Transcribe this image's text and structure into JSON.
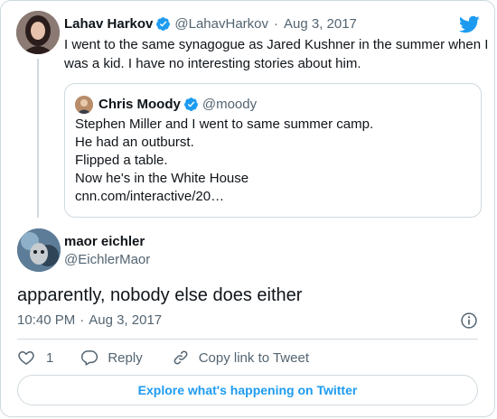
{
  "parent_tweet": {
    "display_name": "Lahav Harkov",
    "handle": "@LahavHarkov",
    "separator": "·",
    "date": "Aug 3, 2017",
    "text": "I went to the same synagogue as Jared Kushner in the summer when I was a kid. I have no interesting stories about him."
  },
  "quoted_tweet": {
    "display_name": "Chris Moody",
    "handle": "@moody",
    "lines": [
      "Stephen Miller and I went to same summer camp.",
      "He had an outburst.",
      "Flipped a table.",
      "Now he's in the White House",
      "cnn.com/interactive/20…"
    ]
  },
  "main_tweet": {
    "display_name": "maor eichler",
    "handle": "@EichlerMaor",
    "text": "apparently, nobody else does either",
    "time": "10:40 PM",
    "separator": "·",
    "date": "Aug 3, 2017"
  },
  "actions": {
    "like_count": "1",
    "reply_label": "Reply",
    "copy_label": "Copy link to Tweet"
  },
  "explore_label": "Explore what's happening on Twitter",
  "icons": {
    "brand": "twitter-bird-icon",
    "verified": "verified-badge-icon",
    "info": "info-icon",
    "like": "heart-icon",
    "reply": "reply-bubble-icon",
    "copy": "link-icon"
  },
  "colors": {
    "brand_blue": "#1d9bf0",
    "text_primary": "#0f1419",
    "text_secondary": "#536471",
    "border": "#cfd9de"
  }
}
